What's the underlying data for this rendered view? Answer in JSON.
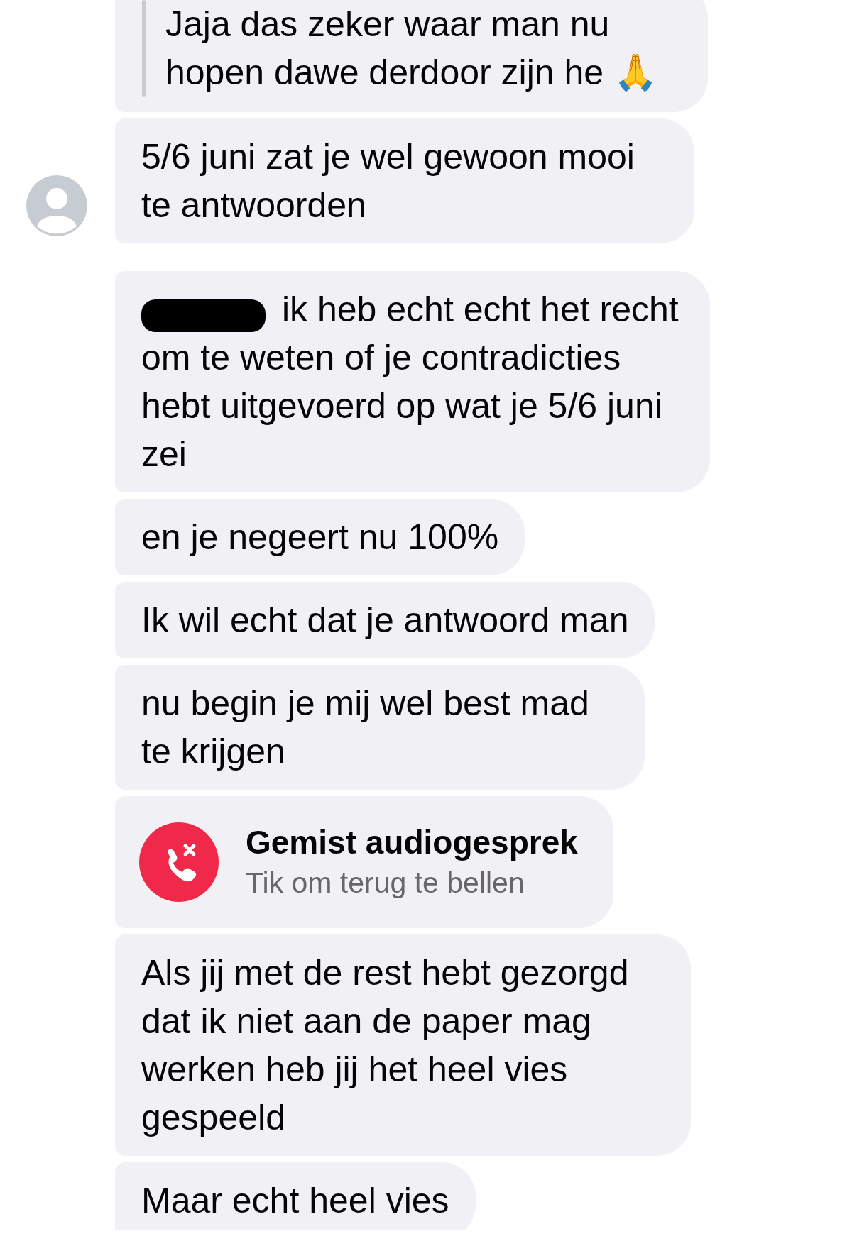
{
  "messages": [
    {
      "kind": "reply",
      "text": "Jaja das zeker waar man nu hopen dawe derdoor zijn he 🙏",
      "avatar": false
    },
    {
      "kind": "text",
      "text": "5/6 juni zat je wel gewoon mooi te antwoorden",
      "avatar": true,
      "redacted": false
    },
    {
      "kind": "text",
      "text": "ik heb echt echt het recht om te weten of je contradicties hebt uitgevoerd op wat je 5/6 juni zei",
      "avatar": false,
      "redacted": true
    },
    {
      "kind": "text",
      "text": "en je negeert nu 100%",
      "avatar": false,
      "redacted": false
    },
    {
      "kind": "text",
      "text": "Ik wil echt dat je antwoord man",
      "avatar": false,
      "redacted": false
    },
    {
      "kind": "text",
      "text": "nu begin je mij wel best mad te krijgen",
      "avatar": false,
      "redacted": false
    },
    {
      "kind": "missed_call",
      "title": "Gemist audiogesprek",
      "subtitle": "Tik om terug te bellen",
      "avatar": false
    },
    {
      "kind": "text",
      "text": "Als jij met de rest hebt gezorgd dat ik niet aan de paper mag werken heb jij het heel vies gespeeld",
      "avatar": false,
      "redacted": false
    },
    {
      "kind": "text",
      "text": "Maar echt heel vies",
      "avatar": false,
      "redacted": false
    }
  ]
}
